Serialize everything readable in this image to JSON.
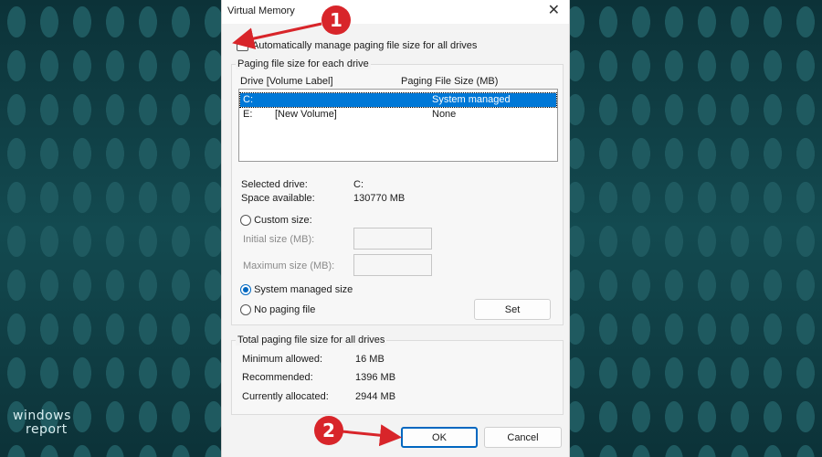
{
  "dialog": {
    "title": "Virtual Memory",
    "close_label": "✕",
    "auto_manage_label": "Automatically manage paging file size for all drives",
    "auto_manage_checked": false
  },
  "drives_group": {
    "legend": "Paging file size for each drive",
    "col_drive": "Drive  [Volume Label]",
    "col_size": "Paging File Size (MB)",
    "rows": [
      {
        "drive": "C:",
        "label": "",
        "size": "System managed",
        "selected": true
      },
      {
        "drive": "E:",
        "label": "[New Volume]",
        "size": "None",
        "selected": false
      }
    ],
    "selected_drive_label": "Selected drive:",
    "selected_drive_value": "C:",
    "space_label": "Space available:",
    "space_value": "130770 MB",
    "custom_size_label": "Custom size:",
    "initial_size_label": "Initial size (MB):",
    "max_size_label": "Maximum size (MB):",
    "system_managed_label": "System managed size",
    "no_paging_label": "No paging file",
    "set_label": "Set"
  },
  "total_group": {
    "legend": "Total paging file size for all drives",
    "min_label": "Minimum allowed:",
    "min_value": "16 MB",
    "rec_label": "Recommended:",
    "rec_value": "1396 MB",
    "alloc_label": "Currently allocated:",
    "alloc_value": "2944 MB"
  },
  "buttons": {
    "ok": "OK",
    "cancel": "Cancel"
  },
  "annotations": {
    "step1": "1",
    "step2": "2",
    "arrow_color": "#d8252a"
  },
  "watermark": {
    "line1": "windows",
    "line2": "report"
  }
}
